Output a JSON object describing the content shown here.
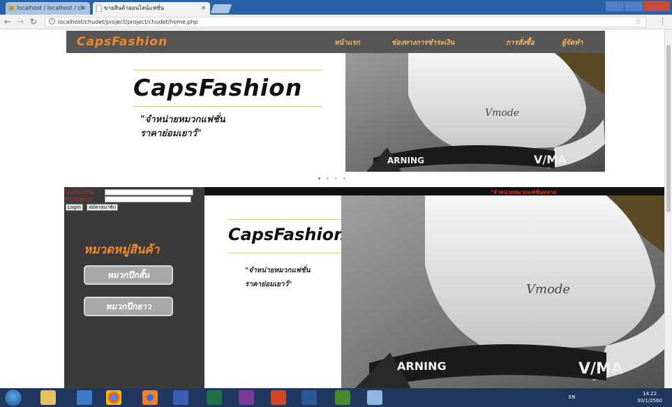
{
  "browser": {
    "tabs": [
      {
        "label": "localhost / localhost / ch",
        "active": false
      },
      {
        "label": "ขายสินค้าออนไลน์แฟชั่น",
        "active": true
      }
    ],
    "url": "localhost/chudet/project/project/chudet/home.php",
    "icons": [
      "back-icon",
      "forward-icon",
      "reload-icon",
      "info-icon",
      "star-icon",
      "menu-icon"
    ]
  },
  "site": {
    "brand": "CapsFashion",
    "nav": [
      "หน้าแรก",
      "ช่องทางการชำระเงิน",
      "การสั่งซื้อ",
      "ผู้จัดทำ"
    ],
    "slider": {
      "title": "CapsFashion",
      "tagline_line1": "\"จำหน่ายหมวกแฟชั่น",
      "tagline_line2": "ราคาย่อมเยาว์\"",
      "dot_count": 4,
      "active_dot": 0
    },
    "login": {
      "username_label": "Username",
      "password_label": "Password",
      "login_button": "Login",
      "register_button": "สมัครสมาชิก"
    },
    "categories": {
      "title": "หมวดหมู่สินค้า",
      "items": [
        "หมวกปีกสั้น",
        "หมวกปีกยาว"
      ]
    },
    "marquee": "\"จำหน่ายหมวกแฟชั่นหลาย",
    "banner": {
      "title": "CapsFashion",
      "tagline_line1": "\"จำหน่ายหมวกแฟชั่น",
      "tagline_line2": "ราคาย่อมเยาว์\""
    }
  },
  "taskbar": {
    "apps": [
      "explorer-icon",
      "media-player-icon",
      "chrome-icon",
      "firefox-icon",
      "visio-icon",
      "excel-icon",
      "onenote-icon",
      "powerpoint-icon",
      "word-icon",
      "dreamweaver-icon",
      "paint-icon"
    ],
    "language": "EN",
    "time": "14:22",
    "date": "30/1/2560"
  },
  "colors": {
    "accent": "#ef8a2a",
    "nav_bg": "#565656",
    "sidebar_bg": "#3b3b3b",
    "alert": "#e53122"
  }
}
